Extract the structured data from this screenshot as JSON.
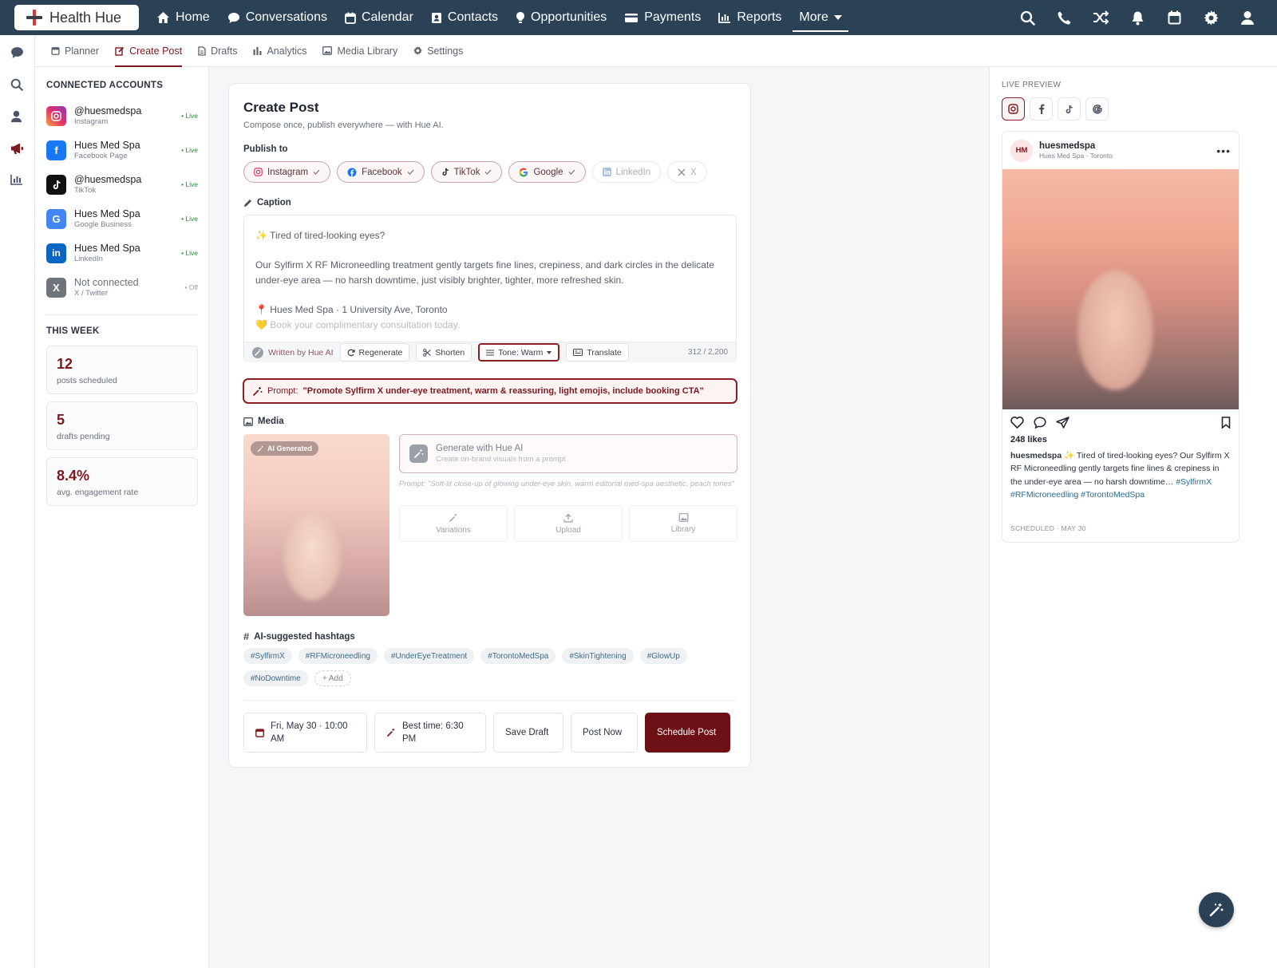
{
  "brand": {
    "name": "Health Hue"
  },
  "topnav": {
    "items": [
      {
        "label": "Home",
        "icon": "home-icon"
      },
      {
        "label": "Conversations",
        "icon": "chat-icon"
      },
      {
        "label": "Calendar",
        "icon": "calendar-icon"
      },
      {
        "label": "Contacts",
        "icon": "contacts-icon"
      },
      {
        "label": "Opportunities",
        "icon": "lightbulb-icon"
      },
      {
        "label": "Payments",
        "icon": "card-icon"
      },
      {
        "label": "Reports",
        "icon": "chart-icon"
      },
      {
        "label": "More",
        "icon": "caret-down-icon"
      }
    ],
    "right_icons": [
      "search-icon",
      "phone-icon",
      "shuffle-icon",
      "bell-icon",
      "calendar-icon",
      "gear-icon",
      "user-icon"
    ]
  },
  "rail": {
    "icons": [
      "chat-icon",
      "search-icon",
      "user-icon",
      "megaphone-icon",
      "chart-icon"
    ]
  },
  "subnav": {
    "tabs": [
      {
        "label": "Planner",
        "active": false
      },
      {
        "label": "Create Post",
        "active": true
      },
      {
        "label": "Drafts",
        "active": false
      },
      {
        "label": "Analytics",
        "active": false
      },
      {
        "label": "Media Library",
        "active": false
      },
      {
        "label": "Settings",
        "active": false
      }
    ]
  },
  "left": {
    "accounts_title": "CONNECTED ACCOUNTS",
    "accounts": [
      {
        "name": "@huesmedspa",
        "platform": "Instagram",
        "status": "• Live",
        "color": "#e1306c",
        "glyph": "◎"
      },
      {
        "name": "Hues Med Spa",
        "platform": "Facebook Page",
        "status": "• Live",
        "color": "#1877f2",
        "glyph": "f"
      },
      {
        "name": "@huesmedspa",
        "platform": "TikTok",
        "status": "• Live",
        "color": "#111111",
        "glyph": "♪"
      },
      {
        "name": "Hues Med Spa",
        "platform": "Google Business",
        "status": "• Live",
        "color": "#4285f4",
        "glyph": "G"
      },
      {
        "name": "Hues Med Spa",
        "platform": "LinkedIn",
        "status": "• Live",
        "color": "#0a66c2",
        "glyph": "in"
      },
      {
        "name": "Not connected",
        "platform": "X / Twitter",
        "status": "• Off",
        "color": "#6f737a",
        "glyph": "X"
      }
    ],
    "week_title": "THIS WEEK",
    "stats": [
      {
        "value": "12",
        "label": "posts scheduled"
      },
      {
        "value": "5",
        "label": "drafts pending"
      },
      {
        "value": "8.4%",
        "label": "avg. engagement rate"
      }
    ]
  },
  "composer": {
    "title": "Create Post",
    "subtitle": "Compose once, publish everywhere — with Hue AI.",
    "publish_label": "Publish to",
    "platforms": [
      {
        "label": "Instagram",
        "selected": true
      },
      {
        "label": "Facebook",
        "selected": true
      },
      {
        "label": "TikTok",
        "selected": true
      },
      {
        "label": "Google",
        "selected": true
      },
      {
        "label": "LinkedIn",
        "selected": false
      },
      {
        "label": "X",
        "selected": false
      }
    ],
    "caption_label": "Caption",
    "caption": {
      "line1": "✨ Tired of tired-looking eyes?",
      "para": "Our Sylfirm X RF Microneedling treatment gently targets fine lines, crepiness, and dark circles in the delicate under-eye area — no harsh downtime, just visibly brighter, tighter, more refreshed skin.",
      "location": "📍 Hues Med Spa · 1 University Ave, Toronto",
      "cta": "💛 Book your complimentary consultation today."
    },
    "tools": {
      "written_by": "Written by Hue AI",
      "regenerate": "Regenerate",
      "shorten": "Shorten",
      "tone": "Tone: Warm",
      "translate": "Translate",
      "count": "312 / 2,200"
    },
    "prompt": {
      "prefix": "Prompt:",
      "text": "\"Promote Sylfirm X under-eye treatment, warm & reassuring, light emojis, include booking CTA\""
    },
    "media_label": "Media",
    "media_badge": "AI Generated",
    "generate": {
      "title": "Generate with Hue AI",
      "subtitle": "Create on-brand visuals from a prompt",
      "prompt": "Prompt: \"Soft-lit close-up of glowing under-eye skin, warm editorial med-spa aesthetic, peach tones\""
    },
    "media_buttons": [
      "Variations",
      "Upload",
      "Library"
    ],
    "hashtags_label": "AI-suggested hashtags",
    "hashtags": [
      "#SylfirmX",
      "#RFMicroneedling",
      "#UnderEyeTreatment",
      "#TorontoMedSpa",
      "#SkinTightening",
      "#GlowUp",
      "#NoDowntime"
    ],
    "add_tag": "+ Add",
    "date": "Fri, May 30 · 10:00 AM",
    "best_time": "Best time: 6:30 PM",
    "save_draft": "Save Draft",
    "post_now": "Post Now",
    "schedule": "Schedule Post"
  },
  "preview": {
    "title": "LIVE PREVIEW",
    "avatar": "HM",
    "username": "huesmedspa",
    "location": "Hues Med Spa · Toronto",
    "likes": "248 likes",
    "text_user": "huesmedspa",
    "text_body": " ✨ Tired of tired-looking eyes? Our Sylfirm X RF Microneedling gently targets fine lines & crepiness in the under-eye area — no harsh downtime… ",
    "text_tags": "#SylfirmX #RFMicroneedling #TorontoMedSpa",
    "scheduled": "SCHEDULED · MAY 30"
  },
  "colors": {
    "brand": "#7a1a1f",
    "nav": "#2b4256"
  }
}
